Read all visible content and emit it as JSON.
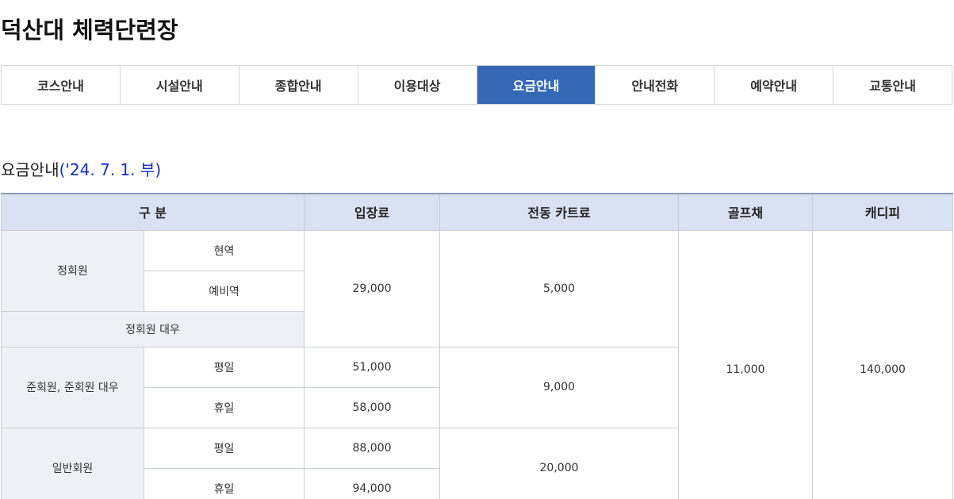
{
  "page_title": "덕산대 체력단련장",
  "tabs": [
    {
      "label": "코스안내",
      "active": false
    },
    {
      "label": "시설안내",
      "active": false
    },
    {
      "label": "종합안내",
      "active": false
    },
    {
      "label": "이용대상",
      "active": false
    },
    {
      "label": "요금안내",
      "active": true
    },
    {
      "label": "안내전화",
      "active": false
    },
    {
      "label": "예약안내",
      "active": false
    },
    {
      "label": "교통안내",
      "active": false
    }
  ],
  "section": {
    "heading": "요금안내",
    "date_note": "('24. 7. 1. 부)"
  },
  "colors": {
    "active_tab": "#3569b5",
    "header_bg": "#d9e2f3",
    "category_bg": "#eef0f5",
    "date_text": "#1a2dc8"
  },
  "table": {
    "headers": {
      "category": "구 분",
      "entry_fee": "입장료",
      "cart_fee": "전동 카트료",
      "golf_club": "골프채",
      "caddie_fee": "캐디피"
    },
    "regular": {
      "label": "정회원",
      "active_duty": "현역",
      "reserve": "예비역",
      "equivalent": "정회원 대우",
      "entry_fee": "29,000",
      "cart_fee": "5,000"
    },
    "associate": {
      "label": "준회원, 준회원 대우",
      "weekday": "평일",
      "weekday_fee": "51,000",
      "holiday": "휴일",
      "holiday_fee": "58,000",
      "cart_fee": "9,000"
    },
    "general": {
      "label": "일반회원",
      "weekday": "평일",
      "weekday_fee": "88,000",
      "holiday": "휴일",
      "holiday_fee": "94,000",
      "cart_fee": "20,000"
    },
    "golf_club_fee": "11,000",
    "caddie_fee": "140,000"
  }
}
